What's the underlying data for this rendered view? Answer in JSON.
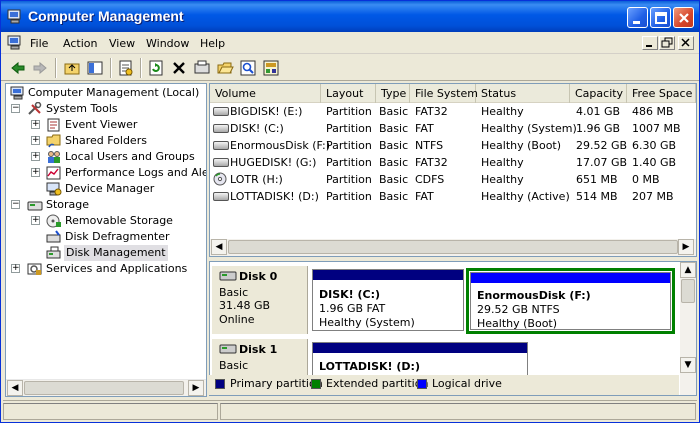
{
  "window": {
    "title": "Computer Management"
  },
  "menu": [
    "File",
    "Action",
    "View",
    "Window",
    "Help"
  ],
  "tree": {
    "root": "Computer Management (Local)",
    "system_tools": "System Tools",
    "event_viewer": "Event Viewer",
    "shared_folders": "Shared Folders",
    "local_users": "Local Users and Groups",
    "perf_logs": "Performance Logs and Alerts",
    "device_manager": "Device Manager",
    "storage": "Storage",
    "removable_storage": "Removable Storage",
    "defrag": "Disk Defragmenter",
    "disk_management": "Disk Management",
    "services": "Services and Applications"
  },
  "columns": [
    "Volume",
    "Layout",
    "Type",
    "File System",
    "Status",
    "Capacity",
    "Free Space"
  ],
  "rows": [
    {
      "volume": "BIGDISK! (E:)",
      "layout": "Partition",
      "type": "Basic",
      "fs": "FAT32",
      "status": "Healthy",
      "capacity": "4.01 GB",
      "free": "486 MB",
      "icon": "drive-icon"
    },
    {
      "volume": "DISK! (C:)",
      "layout": "Partition",
      "type": "Basic",
      "fs": "FAT",
      "status": "Healthy (System)",
      "capacity": "1.96 GB",
      "free": "1007 MB",
      "icon": "drive-icon"
    },
    {
      "volume": "EnormousDisk (F:)",
      "layout": "Partition",
      "type": "Basic",
      "fs": "NTFS",
      "status": "Healthy (Boot)",
      "capacity": "29.52 GB",
      "free": "6.30 GB",
      "icon": "drive-icon"
    },
    {
      "volume": "HUGEDISK! (G:)",
      "layout": "Partition",
      "type": "Basic",
      "fs": "FAT32",
      "status": "Healthy",
      "capacity": "17.07 GB",
      "free": "1.40 GB",
      "icon": "drive-icon"
    },
    {
      "volume": "LOTR (H:)",
      "layout": "Partition",
      "type": "Basic",
      "fs": "CDFS",
      "status": "Healthy",
      "capacity": "651 MB",
      "free": "0 MB",
      "icon": "cd-icon"
    },
    {
      "volume": "LOTTADISK! (D:)",
      "layout": "Partition",
      "type": "Basic",
      "fs": "FAT",
      "status": "Healthy (Active)",
      "capacity": "514 MB",
      "free": "207 MB",
      "icon": "drive-icon"
    }
  ],
  "disks": [
    {
      "name": "Disk 0",
      "type": "Basic",
      "size": "31.48 GB",
      "state": "Online",
      "partitions": [
        {
          "name": "DISK!  (C:)",
          "detail": "1.96 GB FAT",
          "status": "Healthy (System)"
        },
        {
          "name": "EnormousDisk  (F:)",
          "detail": "29.52 GB NTFS",
          "status": "Healthy (Boot)"
        }
      ]
    },
    {
      "name": "Disk 1",
      "type": "Basic",
      "size": "",
      "partitions": [
        {
          "name": "LOTTADISK!  (D:)"
        }
      ]
    }
  ],
  "legend": [
    "Primary partition",
    "Extended partition",
    "Logical drive"
  ],
  "colors": {
    "primary": "#000080",
    "extended": "#008000",
    "logical": "#0000ff",
    "title_bar": "#0054e3",
    "selection": "#008000"
  }
}
